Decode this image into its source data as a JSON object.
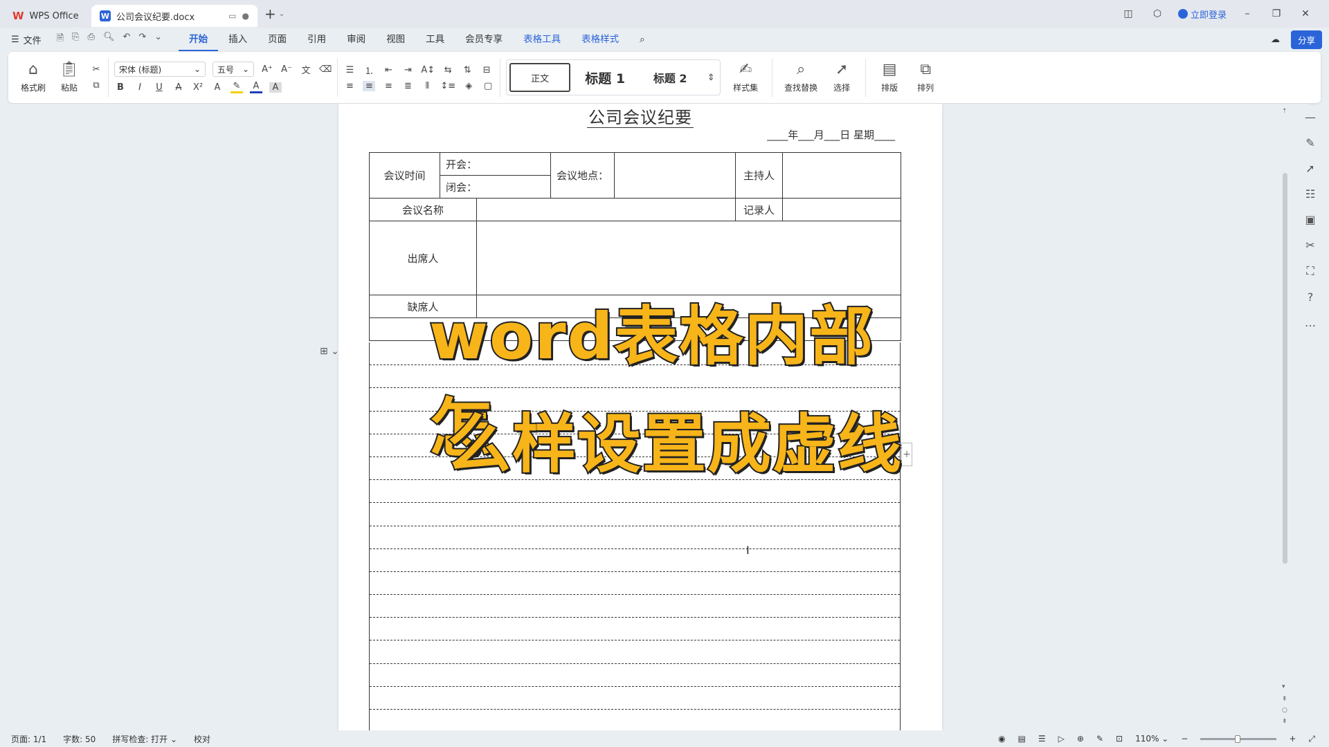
{
  "titlebar": {
    "home_tab": "WPS Office",
    "doc_tab": "公司会议纪要.docx",
    "login": "立即登录"
  },
  "menu": {
    "file": "文件",
    "items": [
      "开始",
      "插入",
      "页面",
      "引用",
      "审阅",
      "视图",
      "工具",
      "会员专享"
    ],
    "context_items": [
      "表格工具",
      "表格样式"
    ],
    "share": "分享"
  },
  "ribbon": {
    "format_painter": "格式刷",
    "paste": "粘贴",
    "font_name": "宋体 (标题)",
    "font_size": "五号",
    "styles": {
      "normal": "正文",
      "h1": "标题 1",
      "h2": "标题 2"
    },
    "style_set": "样式集",
    "find_replace": "查找替换",
    "select": "选择",
    "layout": "排版",
    "arrange": "排列"
  },
  "document": {
    "title": "公司会议纪要",
    "date_line": "____年___月___日 星期____",
    "table": {
      "meeting_time": "会议时间",
      "start": "开会：",
      "end": "闭会：",
      "location": "会议地点：",
      "host": "主持人",
      "meeting_name": "会议名称",
      "recorder": "记录人",
      "attendees": "出席人",
      "absent": "缺席人"
    }
  },
  "overlay": {
    "line1": "word表格内部怎",
    "line2": "么样设置成虚线"
  },
  "statusbar": {
    "page": "页面: 1/1",
    "words": "字数: 50",
    "spell": "拼写检查: 打开",
    "proof": "校对",
    "zoom": "110%"
  }
}
